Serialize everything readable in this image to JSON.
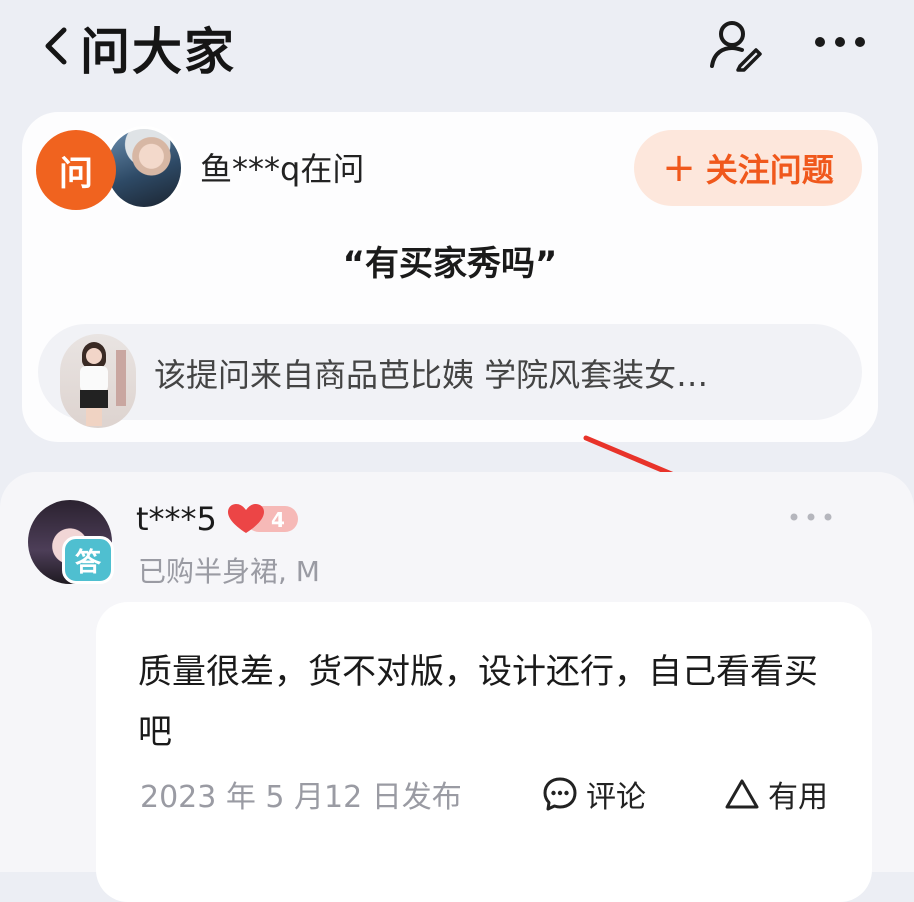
{
  "header": {
    "title": "问大家"
  },
  "question_card": {
    "badge": "问",
    "asker": "鱼***q在问",
    "follow_label": "关注问题",
    "follow_plus": "+",
    "question": "“有买家秀吗”",
    "product_source": "该提问来自商品芭比姨 学院风套装女…"
  },
  "answer": {
    "badge": "答",
    "user": "t***5",
    "level": "4",
    "purchase": "已购半身裙, M",
    "text": "质量很差，货不对版，设计还行，自己看看买吧",
    "date": "2023 年 5 月12 日发布",
    "comment_label": "评论",
    "useful_label": "有用"
  },
  "colors": {
    "accent_orange": "#f0631f",
    "follow_bg": "#fde7dc",
    "answer_badge": "#4fbfd0",
    "annotation_arrow": "#e8332a"
  }
}
